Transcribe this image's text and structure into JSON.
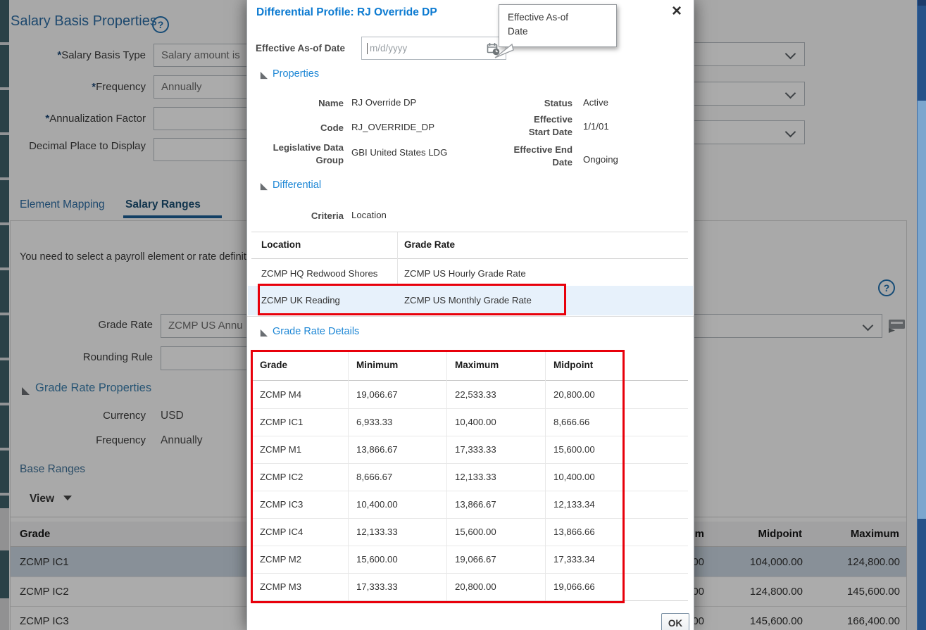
{
  "colors": {
    "accent_blue": "#0b7ad1",
    "section_blue": "#1e87d5",
    "annotation_red": "#e8000b",
    "highlight_row": "#e7f1fb",
    "selected_row": "#cbd7e3"
  },
  "page": {
    "title": "Salary Basis Properties",
    "required_marker": "*",
    "form": {
      "salary_basis_type_label": "Salary Basis Type",
      "salary_basis_type_value": "Salary amount is",
      "frequency_label": "Frequency",
      "frequency_value": "Annually",
      "annualization_factor_label": "Annualization Factor",
      "decimal_place_label": "Decimal Place to Display"
    },
    "tabs": {
      "element_mapping": "Element Mapping",
      "salary_ranges": "Salary Ranges"
    },
    "panel": {
      "message": "You need to select a payroll element or rate definit",
      "grade_rate_label": "Grade Rate",
      "grade_rate_value": "ZCMP US Annu",
      "rounding_rule_label": "Rounding Rule",
      "grade_rate_properties_section": "Grade Rate Properties",
      "currency_label": "Currency",
      "currency_value": "USD",
      "frequency_label": "Frequency",
      "frequency_value": "Annually",
      "base_ranges_label": "Base Ranges",
      "view_label": "View"
    },
    "base_ranges_table": {
      "col_grade": "Grade",
      "col_minimum_fragment": "m",
      "col_midpoint": "Midpoint",
      "col_maximum": "Maximum",
      "rows": [
        {
          "grade": "ZCMP IC1",
          "minimum_fragment": "00",
          "midpoint": "104,000.00",
          "maximum": "124,800.00"
        },
        {
          "grade": "ZCMP IC2",
          "minimum_fragment": "00",
          "midpoint": "124,800.00",
          "maximum": "145,600.00"
        },
        {
          "grade": "ZCMP IC3",
          "minimum_fragment": "00",
          "midpoint": "145,600.00",
          "maximum": "166,400.00"
        }
      ]
    }
  },
  "modal": {
    "title": "Differential Profile: RJ Override DP",
    "close_label": "×",
    "effective_date_label": "Effective As-of Date",
    "effective_date_placeholder": "m/d/yyyy",
    "tooltip_text": "Effective As-of Date",
    "sections": {
      "properties": "Properties",
      "differential": "Differential",
      "grade_rate_details": "Grade Rate Details"
    },
    "properties": {
      "name_label": "Name",
      "name_value": "RJ Override DP",
      "code_label": "Code",
      "code_value": "RJ_OVERRIDE_DP",
      "ldg_label": "Legislative Data Group",
      "ldg_value": "GBI United States LDG",
      "status_label": "Status",
      "status_value": "Active",
      "effective_start_label": "Effective Start Date",
      "effective_start_value": "1/1/01",
      "effective_end_label": "Effective End Date",
      "effective_end_value": "Ongoing"
    },
    "differential": {
      "criteria_label": "Criteria",
      "criteria_value": "Location"
    },
    "location_table": {
      "col_location": "Location",
      "col_grade_rate": "Grade Rate",
      "rows": [
        {
          "location": "ZCMP HQ Redwood Shores",
          "grade_rate": "ZCMP US Hourly Grade Rate"
        },
        {
          "location": "ZCMP UK Reading",
          "grade_rate": "ZCMP US Monthly Grade Rate"
        }
      ]
    },
    "grade_rate_details_table": {
      "col_grade": "Grade",
      "col_minimum": "Minimum",
      "col_maximum": "Maximum",
      "col_midpoint": "Midpoint",
      "rows": [
        {
          "grade": "ZCMP M4",
          "minimum": "19,066.67",
          "maximum": "22,533.33",
          "midpoint": "20,800.00"
        },
        {
          "grade": "ZCMP IC1",
          "minimum": "6,933.33",
          "maximum": "10,400.00",
          "midpoint": "8,666.66"
        },
        {
          "grade": "ZCMP M1",
          "minimum": "13,866.67",
          "maximum": "17,333.33",
          "midpoint": "15,600.00"
        },
        {
          "grade": "ZCMP IC2",
          "minimum": "8,666.67",
          "maximum": "12,133.33",
          "midpoint": "10,400.00"
        },
        {
          "grade": "ZCMP IC3",
          "minimum": "10,400.00",
          "maximum": "13,866.67",
          "midpoint": "12,133.34"
        },
        {
          "grade": "ZCMP IC4",
          "minimum": "12,133.33",
          "maximum": "15,600.00",
          "midpoint": "13,866.66"
        },
        {
          "grade": "ZCMP M2",
          "minimum": "15,600.00",
          "maximum": "19,066.67",
          "midpoint": "17,333.34"
        },
        {
          "grade": "ZCMP M3",
          "minimum": "17,333.33",
          "maximum": "20,800.00",
          "midpoint": "19,066.66"
        }
      ]
    },
    "ok_label": "OK"
  }
}
